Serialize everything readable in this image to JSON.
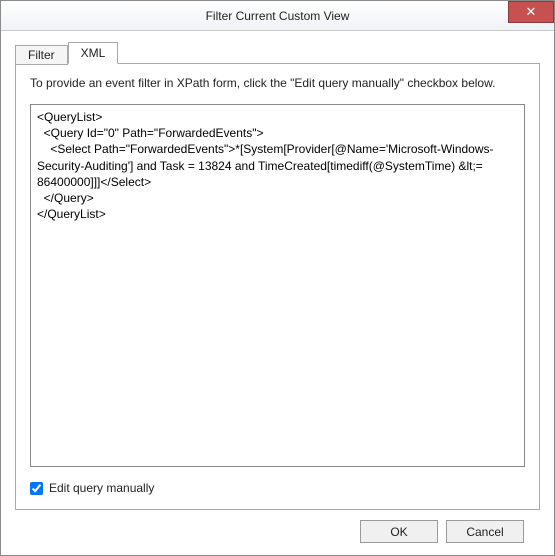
{
  "window": {
    "title": "Filter Current Custom View",
    "close_symbol": "✕"
  },
  "tabs": {
    "filter": {
      "label": "Filter"
    },
    "xml": {
      "label": "XML"
    }
  },
  "panel": {
    "instruction": "To provide an event filter in XPath form, click the \"Edit query manually\" checkbox below.",
    "xml_content": "<QueryList>\n  <Query Id=\"0\" Path=\"ForwardedEvents\">\n    <Select Path=\"ForwardedEvents\">*[System[Provider[@Name='Microsoft-Windows-Security-Auditing'] and Task = 13824 and TimeCreated[timediff(@SystemTime) &lt;= 86400000]]]</Select>\n  </Query>\n</QueryList>",
    "checkbox_label": "Edit query manually",
    "checkbox_checked": true
  },
  "buttons": {
    "ok": "OK",
    "cancel": "Cancel"
  }
}
